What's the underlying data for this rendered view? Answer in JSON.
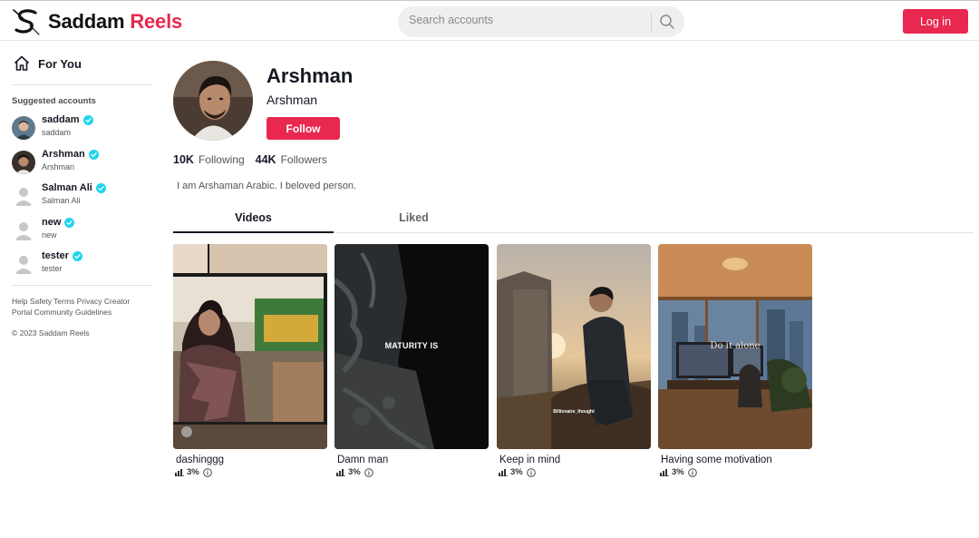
{
  "header": {
    "brand_word1": "Saddam",
    "brand_word2": "Reels",
    "search_placeholder": "Search accounts",
    "login_label": "Log in",
    "brand_color": "#e8284f"
  },
  "sidebar": {
    "for_you_label": "For You",
    "suggested_title": "Suggested accounts",
    "accounts": [
      {
        "name": "saddam",
        "handle": "saddam",
        "verified": true
      },
      {
        "name": "Arshman",
        "handle": "Arshman",
        "verified": true
      },
      {
        "name": "Salman Ali",
        "handle": "Salman Ali",
        "verified": true
      },
      {
        "name": "new",
        "handle": "new",
        "verified": true
      },
      {
        "name": "tester",
        "handle": "tester",
        "verified": true
      }
    ],
    "footer_links": "Help Safety Terms Privacy Creator Portal Community Guidelines",
    "copyright": "© 2023 Saddam Reels"
  },
  "profile": {
    "name": "Arshman",
    "handle": "Arshman",
    "follow_label": "Follow",
    "following_count": "10K",
    "following_label": "Following",
    "followers_count": "44K",
    "followers_label": "Followers",
    "bio": "I am Arshaman Arabic. I beloved person."
  },
  "tabs": [
    {
      "label": "Videos",
      "active": true
    },
    {
      "label": "Liked",
      "active": false
    }
  ],
  "videos": [
    {
      "title": "dashinggg",
      "stat": "3%"
    },
    {
      "title": "Damn man",
      "stat": "3%",
      "overlay_text": "MATURITY IS"
    },
    {
      "title": "Keep in mind",
      "stat": "3%",
      "overlay_text": "Billionaire_thought"
    },
    {
      "title": "Having some motivation",
      "stat": "3%",
      "overlay_text": "Do it alone"
    }
  ]
}
